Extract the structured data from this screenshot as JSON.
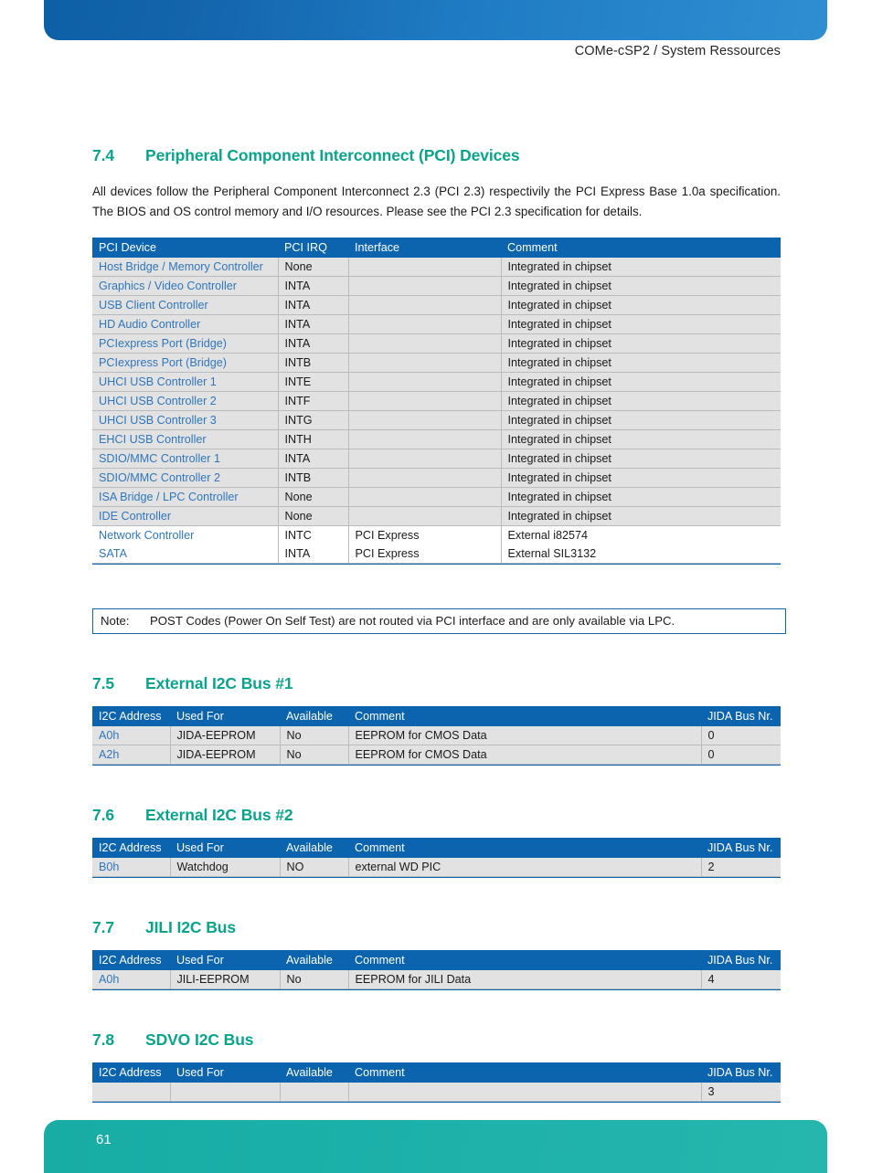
{
  "header": {
    "title": "COMe-cSP2 / System Ressources"
  },
  "footer": {
    "page_number": "61"
  },
  "colors": {
    "heading_teal": "#0aa48c",
    "table_header_blue": "#0b64ad",
    "link_blue": "#2f76bb",
    "row_shade": "#e2e2e2",
    "footer_teal": "#17ada6"
  },
  "sections": {
    "pci": {
      "number": "7.4",
      "title": "Peripheral Component Interconnect (PCI) Devices",
      "paragraph": "All devices follow the Peripheral Component Interconnect 2.3 (PCI 2.3) respectivily the PCI Express Base 1.0a specification. The BIOS and OS control memory and I/O resources. Please see the PCI 2.3 specification for details.",
      "table": {
        "columns": [
          "PCI Device",
          "PCI IRQ",
          "Interface",
          "Comment"
        ],
        "rows": [
          [
            "Host Bridge / Memory Controller",
            "None",
            "",
            "Integrated in chipset"
          ],
          [
            "Graphics / Video Controller",
            "INTA",
            "",
            "Integrated in chipset"
          ],
          [
            "USB Client Controller",
            "INTA",
            "",
            "Integrated in chipset"
          ],
          [
            "HD Audio Controller",
            "INTA",
            "",
            "Integrated in chipset"
          ],
          [
            "PCIexpress Port (Bridge)",
            "INTA",
            "",
            "Integrated in chipset"
          ],
          [
            "PCIexpress Port (Bridge)",
            "INTB",
            "",
            "Integrated in chipset"
          ],
          [
            "UHCI USB Controller 1",
            "INTE",
            "",
            "Integrated in chipset"
          ],
          [
            "UHCI USB Controller 2",
            "INTF",
            "",
            "Integrated in chipset"
          ],
          [
            "UHCI USB Controller 3",
            "INTG",
            "",
            "Integrated in chipset"
          ],
          [
            "EHCI USB Controller",
            "INTH",
            "",
            "Integrated in chipset"
          ],
          [
            "SDIO/MMC Controller 1",
            "INTA",
            "",
            "Integrated in chipset"
          ],
          [
            "SDIO/MMC Controller 2",
            "INTB",
            "",
            "Integrated in chipset"
          ],
          [
            "ISA Bridge / LPC Controller",
            "None",
            "",
            "Integrated in chipset"
          ],
          [
            "IDE Controller",
            "None",
            "",
            "Integrated in chipset"
          ],
          [
            "Network Controller",
            "INTC",
            "PCI Express",
            "External i82574"
          ],
          [
            "SATA",
            "INTA",
            "PCI Express",
            "External SIL3132"
          ]
        ]
      }
    },
    "note": {
      "label": "Note:",
      "text": "POST Codes (Power On Self Test) are not routed via PCI interface and are only available via LPC."
    },
    "i2c_bus_1": {
      "number": "7.5",
      "title": "External I2C Bus #1",
      "table": {
        "columns": [
          "I2C Address",
          "Used For",
          "Available",
          "Comment",
          "JIDA Bus Nr."
        ],
        "rows": [
          [
            "A0h",
            "JIDA-EEPROM",
            "No",
            "EEPROM for CMOS Data",
            "0"
          ],
          [
            "A2h",
            "JIDA-EEPROM",
            "No",
            "EEPROM for CMOS Data",
            "0"
          ]
        ]
      }
    },
    "i2c_bus_2": {
      "number": "7.6",
      "title": "External I2C Bus #2",
      "table": {
        "columns": [
          "I2C Address",
          "Used For",
          "Available",
          "Comment",
          "JIDA Bus Nr."
        ],
        "rows": [
          [
            "B0h",
            "Watchdog",
            "NO",
            "external WD PIC",
            "2"
          ]
        ]
      }
    },
    "jili_i2c": {
      "number": "7.7",
      "title": "JILI I2C Bus",
      "table": {
        "columns": [
          "I2C Address",
          "Used For",
          "Available",
          "Comment",
          "JIDA Bus Nr."
        ],
        "rows": [
          [
            "A0h",
            "JILI-EEPROM",
            "No",
            "EEPROM for JILI Data",
            "4"
          ]
        ]
      }
    },
    "sdvo_i2c": {
      "number": "7.8",
      "title": "SDVO I2C Bus",
      "table": {
        "columns": [
          "I2C Address",
          "Used For",
          "Available",
          "Comment",
          "JIDA Bus Nr."
        ],
        "rows": [
          [
            "",
            "",
            "",
            "",
            "3"
          ]
        ]
      }
    }
  }
}
